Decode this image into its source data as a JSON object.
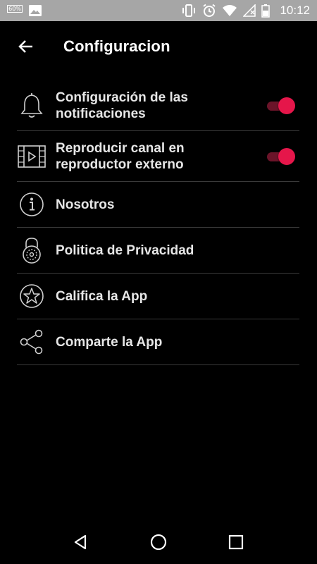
{
  "status_bar": {
    "battery_percent": "60%",
    "time": "10:12",
    "icons": [
      "battery-percent-icon",
      "image-icon",
      "vibrate-icon",
      "alarm-icon",
      "wifi-icon",
      "signal-icon",
      "battery-icon"
    ]
  },
  "app_bar": {
    "back_icon": "arrow-left-icon",
    "title": "Configuracion"
  },
  "settings": {
    "items": [
      {
        "label": "Configuración de las\nnotificaciones",
        "icon": "bell-icon",
        "toggle": true,
        "toggle_on": true
      },
      {
        "label": "Reproducir canal en\nreproductor externo",
        "icon": "video-player-icon",
        "toggle": true,
        "toggle_on": true
      },
      {
        "label": "Nosotros",
        "icon": "info-icon",
        "toggle": false
      },
      {
        "label": "Politica de Privacidad",
        "icon": "lock-icon",
        "toggle": false
      },
      {
        "label": "Califica la App",
        "icon": "star-icon",
        "toggle": false
      },
      {
        "label": "Comparte la App",
        "icon": "share-icon",
        "toggle": false
      }
    ]
  },
  "nav_bar": {
    "buttons": [
      "back-triangle-icon",
      "home-circle-icon",
      "recents-square-icon"
    ]
  },
  "colors": {
    "background": "#000000",
    "status_bar": "#a6a6a6",
    "accent": "#e5164a",
    "accent_track": "#6b1429",
    "divider": "#3a3a3a",
    "text": "#e6e6e6"
  }
}
